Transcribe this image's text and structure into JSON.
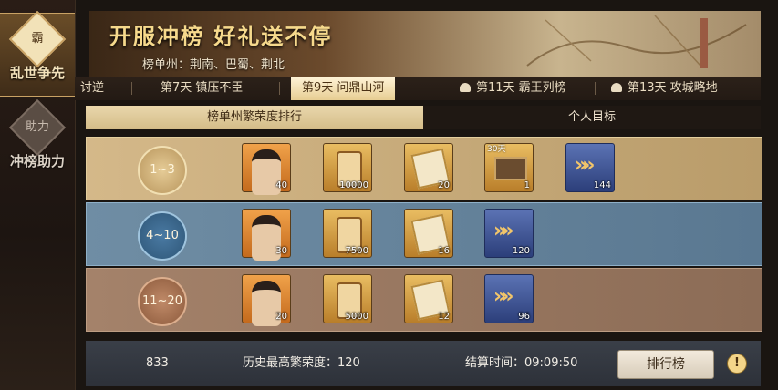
{
  "sidebar": {
    "items": [
      {
        "label": "乱世争先",
        "icon": "crest-icon",
        "icon_glyph": "霸"
      },
      {
        "label": "冲榜助力",
        "icon": "crest-icon",
        "icon_glyph": "助力"
      }
    ]
  },
  "banner": {
    "title": "开服冲榜 好礼送不停",
    "subtitle": "榜单州：荆南、巴蜀、荆北"
  },
  "day_tabs": [
    {
      "label": "讨逆"
    },
    {
      "label": "第7天  镇压不臣"
    },
    {
      "label": "第9天  问鼎山河"
    },
    {
      "label": "第11天  霸王列榜"
    },
    {
      "label": "第13天  攻城略地"
    }
  ],
  "sub_tabs": [
    {
      "label": "榜单州繁荣度排行"
    },
    {
      "label": "个人目标"
    }
  ],
  "ranks": [
    {
      "range": "1~3",
      "rewards": [
        {
          "type": "hero-portrait",
          "qty": "40"
        },
        {
          "type": "scroll",
          "qty": "10000"
        },
        {
          "type": "book",
          "qty": "20"
        },
        {
          "type": "fortress",
          "qty": "1",
          "days": "30天"
        },
        {
          "type": "speedup",
          "qty": "144"
        }
      ]
    },
    {
      "range": "4~10",
      "rewards": [
        {
          "type": "hero-portrait",
          "qty": "30"
        },
        {
          "type": "scroll",
          "qty": "7500"
        },
        {
          "type": "book",
          "qty": "16"
        },
        {
          "type": "speedup",
          "qty": "120"
        }
      ]
    },
    {
      "range": "11~20",
      "rewards": [
        {
          "type": "hero-portrait",
          "qty": "20"
        },
        {
          "type": "scroll",
          "qty": "5000"
        },
        {
          "type": "book",
          "qty": "12"
        },
        {
          "type": "speedup",
          "qty": "96"
        }
      ]
    }
  ],
  "footer": {
    "my_rank": "833",
    "history_label": "历史最高繁荣度：120",
    "settle_label": "结算时间：09:09:50",
    "rank_button": "排行榜",
    "info_glyph": "!"
  }
}
